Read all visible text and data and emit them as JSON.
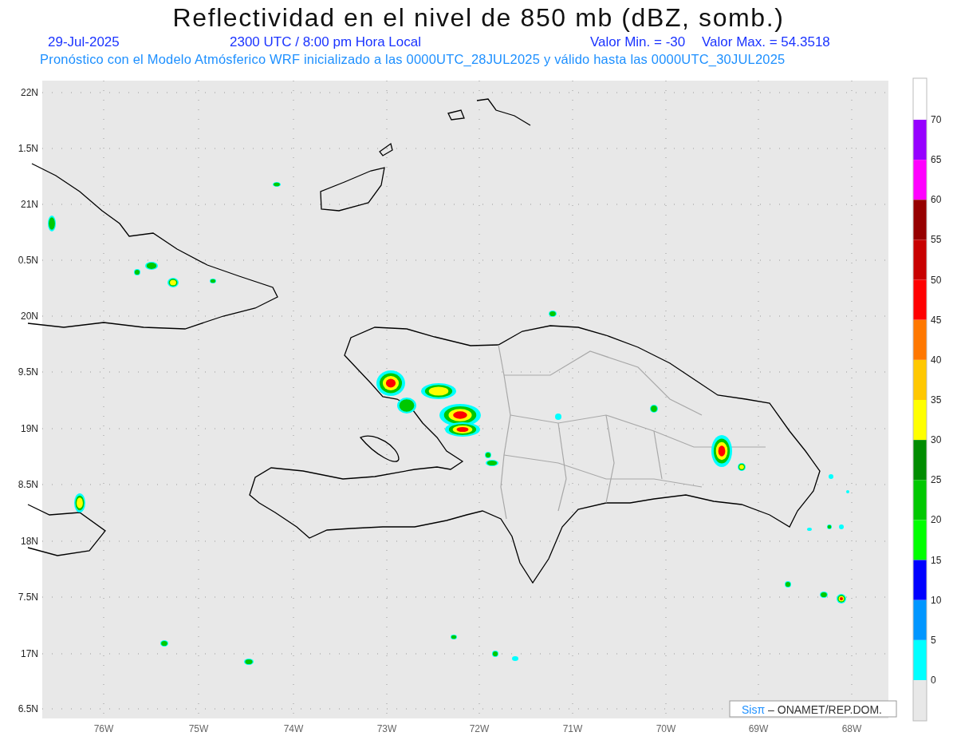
{
  "title": "Reflectividad en el nivel de 850 mb (dBZ, somb.)",
  "info": {
    "date": "29-Jul-2025",
    "time": "2300 UTC / 8:00 pm Hora Local",
    "min": "Valor Min. = -30",
    "max": "Valor Max. = 54.3518"
  },
  "subtitle": "Pronóstico con el Modelo Atmósferico WRF inicializado a las 0000UTC_28JUL2025 y válido hasta las  0000UTC_30JUL2025",
  "map": {
    "lat_labels": [
      "22N",
      "1.5N",
      "21N",
      "0.5N",
      "20N",
      "9.5N",
      "19N",
      "8.5N",
      "18N",
      "7.5N",
      "17N",
      "6.5N"
    ],
    "lon_labels": [
      "76W",
      "75W",
      "74W",
      "73W",
      "72W",
      "71W",
      "70W",
      "69W",
      "68W"
    ]
  },
  "colorbar": {
    "bins": [
      {
        "color": "#9600ff"
      },
      {
        "color": "#ff00ff"
      },
      {
        "color": "#960000"
      },
      {
        "color": "#c80000"
      },
      {
        "color": "#ff0000"
      },
      {
        "color": "#ff7800"
      },
      {
        "color": "#ffc800"
      },
      {
        "color": "#ffff00"
      },
      {
        "color": "#008c00"
      },
      {
        "color": "#00c800"
      },
      {
        "color": "#00ff00"
      },
      {
        "color": "#0000ff"
      },
      {
        "color": "#0096ff"
      },
      {
        "color": "#00ffff"
      }
    ],
    "ticks": [
      "70",
      "65",
      "60",
      "55",
      "50",
      "45",
      "40",
      "35",
      "30",
      "25",
      "20",
      "15",
      "10",
      "5",
      "0"
    ]
  },
  "credit": {
    "brand": "Sisπ",
    "text": "– ONAMET/REP.DOM."
  }
}
